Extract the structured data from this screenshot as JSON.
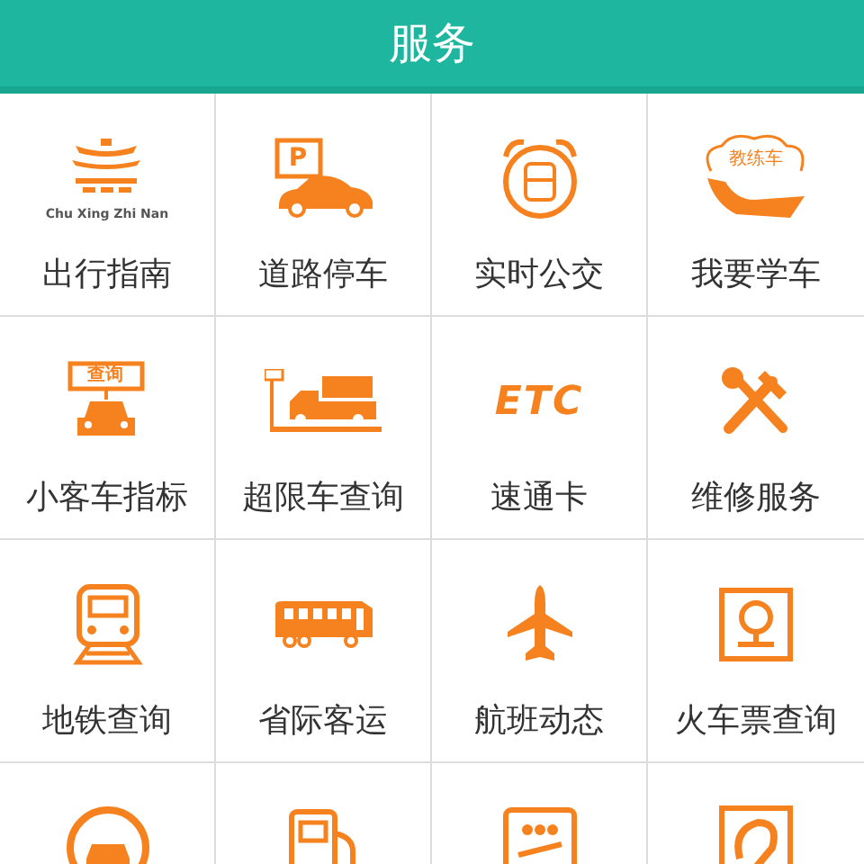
{
  "header": {
    "title": "服务"
  },
  "services": [
    {
      "label": "出行指南",
      "kind": "logo",
      "icon_text": "Chu Xing Zhi Nan"
    },
    {
      "label": "道路停车",
      "kind": "parking",
      "icon_text": "P"
    },
    {
      "label": "实时公交",
      "kind": "busclock"
    },
    {
      "label": "我要学车",
      "kind": "handcloud",
      "icon_text": "教练车"
    },
    {
      "label": "小客车指标",
      "kind": "carsign",
      "icon_text": "查询"
    },
    {
      "label": "超限车查询",
      "kind": "truck"
    },
    {
      "label": "速通卡",
      "kind": "etc",
      "icon_text": "ETC"
    },
    {
      "label": "维修服务",
      "kind": "tools"
    },
    {
      "label": "地铁查询",
      "kind": "train"
    },
    {
      "label": "省际客运",
      "kind": "coach"
    },
    {
      "label": "航班动态",
      "kind": "plane"
    },
    {
      "label": "火车票查询",
      "kind": "rail"
    },
    {
      "kind": "carcircle"
    },
    {
      "kind": "fuel"
    },
    {
      "kind": "ticket"
    },
    {
      "kind": "badge"
    }
  ]
}
